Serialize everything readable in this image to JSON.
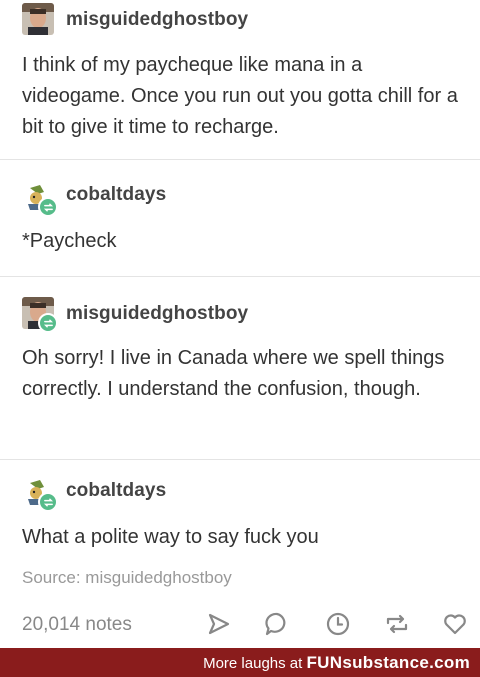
{
  "posts": [
    {
      "username": "misguidedghostboy",
      "text": "I think of my paycheque like mana in a videogame. Once you run out you gotta chill for a bit to give it time to recharge.",
      "avatar": "man-photo",
      "reblog": false
    },
    {
      "username": "cobaltdays",
      "text": "*Paycheck",
      "avatar": "pokemon-sprite",
      "reblog": true
    },
    {
      "username": "misguidedghostboy",
      "text": "Oh sorry! I live in Canada where we spell things correctly. I understand the confusion, though.",
      "avatar": "man-photo",
      "reblog": true
    },
    {
      "username": "cobaltdays",
      "text": "What a polite way to say fuck you",
      "avatar": "pokemon-sprite",
      "reblog": true
    }
  ],
  "source": "Source: misguidedghostboy",
  "footer": {
    "notes": "20,014 notes",
    "icons": [
      "share-icon",
      "reply-icon",
      "clock-icon",
      "reblog-icon",
      "heart-icon"
    ]
  },
  "banner": {
    "prefix": "More laughs at",
    "brand": "FUNsubstance.com",
    "color": "#8a1c1c"
  },
  "colors": {
    "reblog_badge": "#56bc8a",
    "text": "#333333",
    "muted": "#999999"
  }
}
